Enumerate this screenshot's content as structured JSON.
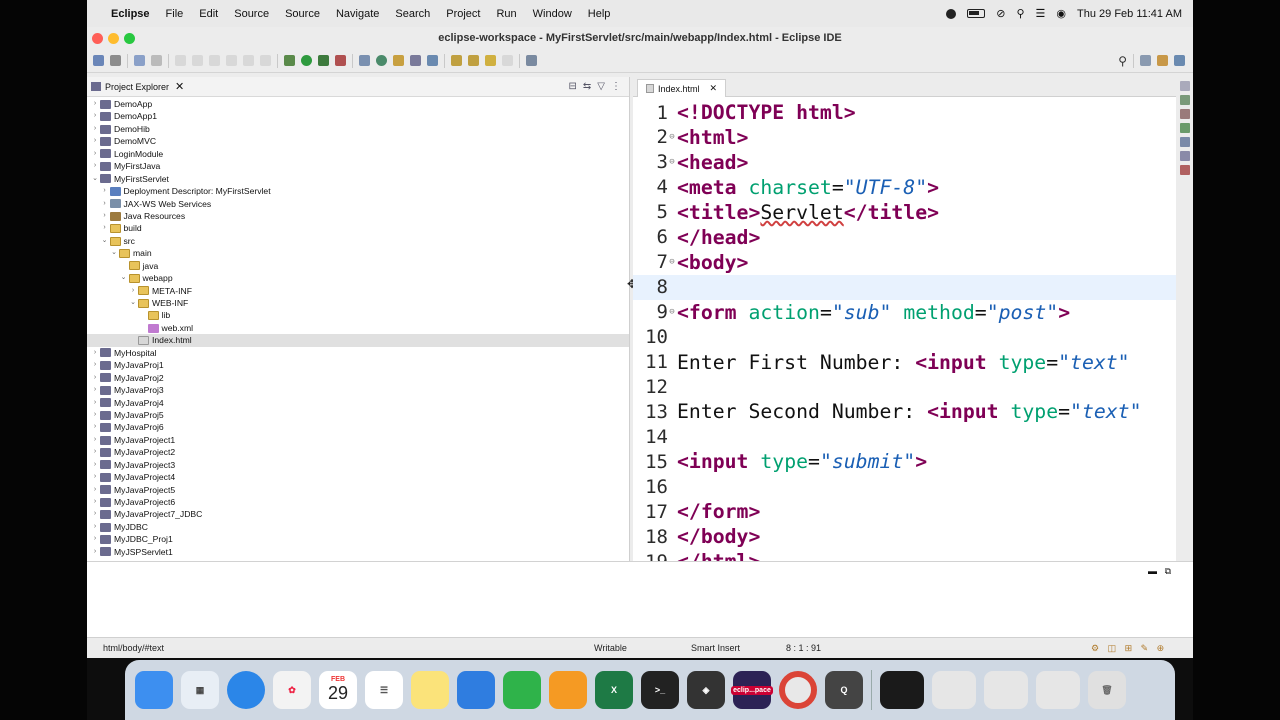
{
  "menubar": {
    "apple": "",
    "app_name": "Eclipse",
    "items": [
      "File",
      "Edit",
      "Source",
      "Source",
      "Navigate",
      "Search",
      "Project",
      "Run",
      "Window",
      "Help"
    ],
    "datetime": "Thu 29 Feb  11:41 AM"
  },
  "window": {
    "title": "eclipse-workspace - MyFirstServlet/src/main/webapp/Index.html - Eclipse IDE"
  },
  "explorer": {
    "title": "Project Explorer",
    "close": "✕",
    "tree": [
      {
        "label": "DemoApp",
        "arrow": "›",
        "icon": "proj",
        "depth": 0
      },
      {
        "label": "DemoApp1",
        "arrow": "›",
        "icon": "proj",
        "depth": 0
      },
      {
        "label": "DemoHib",
        "arrow": "›",
        "icon": "proj",
        "depth": 0
      },
      {
        "label": "DemoMVC",
        "arrow": "›",
        "icon": "proj",
        "depth": 0
      },
      {
        "label": "LoginModule",
        "arrow": "›",
        "icon": "proj",
        "depth": 0
      },
      {
        "label": "MyFirstJava",
        "arrow": "›",
        "icon": "proj",
        "depth": 0
      },
      {
        "label": "MyFirstServlet",
        "arrow": "⌄",
        "icon": "proj",
        "depth": 0
      },
      {
        "label": "Deployment Descriptor: MyFirstServlet",
        "arrow": "›",
        "icon": "desc",
        "depth": 1
      },
      {
        "label": "JAX-WS Web Services",
        "arrow": "›",
        "icon": "ws",
        "depth": 1
      },
      {
        "label": "Java Resources",
        "arrow": "›",
        "icon": "lib",
        "depth": 1
      },
      {
        "label": "build",
        "arrow": "›",
        "icon": "fold",
        "depth": 1
      },
      {
        "label": "src",
        "arrow": "⌄",
        "icon": "fold",
        "depth": 1
      },
      {
        "label": "main",
        "arrow": "⌄",
        "icon": "fold",
        "depth": 2
      },
      {
        "label": "java",
        "arrow": "",
        "icon": "fold",
        "depth": 3
      },
      {
        "label": "webapp",
        "arrow": "⌄",
        "icon": "fold",
        "depth": 3
      },
      {
        "label": "META-INF",
        "arrow": "›",
        "icon": "fold",
        "depth": 4
      },
      {
        "label": "WEB-INF",
        "arrow": "⌄",
        "icon": "fold",
        "depth": 4
      },
      {
        "label": "lib",
        "arrow": "",
        "icon": "fold",
        "depth": 5
      },
      {
        "label": "web.xml",
        "arrow": "",
        "icon": "xml",
        "depth": 5
      },
      {
        "label": "Index.html",
        "arrow": "",
        "icon": "html",
        "depth": 4,
        "selected": true
      },
      {
        "label": "MyHospital",
        "arrow": "›",
        "icon": "proj",
        "depth": 0
      },
      {
        "label": "MyJavaProj1",
        "arrow": "›",
        "icon": "proj",
        "depth": 0
      },
      {
        "label": "MyJavaProj2",
        "arrow": "›",
        "icon": "proj",
        "depth": 0
      },
      {
        "label": "MyJavaProj3",
        "arrow": "›",
        "icon": "proj",
        "depth": 0
      },
      {
        "label": "MyJavaProj4",
        "arrow": "›",
        "icon": "proj",
        "depth": 0
      },
      {
        "label": "MyJavaProj5",
        "arrow": "›",
        "icon": "proj",
        "depth": 0
      },
      {
        "label": "MyJavaProj6",
        "arrow": "›",
        "icon": "proj",
        "depth": 0
      },
      {
        "label": "MyJavaProject1",
        "arrow": "›",
        "icon": "proj",
        "depth": 0
      },
      {
        "label": "MyJavaProject2",
        "arrow": "›",
        "icon": "proj",
        "depth": 0
      },
      {
        "label": "MyJavaProject3",
        "arrow": "›",
        "icon": "proj",
        "depth": 0
      },
      {
        "label": "MyJavaProject4",
        "arrow": "›",
        "icon": "proj",
        "depth": 0
      },
      {
        "label": "MyJavaProject5",
        "arrow": "›",
        "icon": "proj",
        "depth": 0
      },
      {
        "label": "MyJavaProject6",
        "arrow": "›",
        "icon": "proj",
        "depth": 0
      },
      {
        "label": "MyJavaProject7_JDBC",
        "arrow": "›",
        "icon": "proj",
        "depth": 0
      },
      {
        "label": "MyJDBC",
        "arrow": "›",
        "icon": "proj",
        "depth": 0
      },
      {
        "label": "MyJDBC_Proj1",
        "arrow": "›",
        "icon": "proj",
        "depth": 0
      },
      {
        "label": "MyJSPServlet1",
        "arrow": "›",
        "icon": "proj",
        "depth": 0
      }
    ]
  },
  "editor": {
    "tab_label": "Index.html",
    "tab_close": "✕",
    "current_line": 8,
    "lines": [
      {
        "n": "1",
        "fold": "",
        "tokens": [
          [
            "tg",
            "<!DOCTYPE html>"
          ]
        ]
      },
      {
        "n": "2",
        "fold": "⊖",
        "tokens": [
          [
            "tg",
            "<html>"
          ]
        ]
      },
      {
        "n": "3",
        "fold": "⊖",
        "tokens": [
          [
            "tg",
            "<head>"
          ]
        ]
      },
      {
        "n": "4",
        "fold": "",
        "tokens": [
          [
            "tg",
            "<meta "
          ],
          [
            "at",
            "charset"
          ],
          [
            "tx",
            "="
          ],
          [
            "st",
            "\"UTF-8\""
          ],
          [
            "tg",
            ">"
          ]
        ]
      },
      {
        "n": "5",
        "fold": "",
        "tokens": [
          [
            "tg",
            "<title>"
          ],
          [
            "sq",
            "Servlet"
          ],
          [
            "tg",
            "</title>"
          ]
        ]
      },
      {
        "n": "6",
        "fold": "",
        "tokens": [
          [
            "tg",
            "</head>"
          ]
        ]
      },
      {
        "n": "7",
        "fold": "⊖",
        "tokens": [
          [
            "tg",
            "<body>"
          ]
        ]
      },
      {
        "n": "8",
        "fold": "",
        "tokens": []
      },
      {
        "n": "9",
        "fold": "⊖",
        "tokens": [
          [
            "tg",
            "<form "
          ],
          [
            "at",
            "action"
          ],
          [
            "tx",
            "="
          ],
          [
            "st",
            "\"sub\""
          ],
          [
            "tx",
            " "
          ],
          [
            "at",
            "method"
          ],
          [
            "tx",
            "="
          ],
          [
            "st",
            "\"post\""
          ],
          [
            "tg",
            ">"
          ]
        ]
      },
      {
        "n": "10",
        "fold": "",
        "tokens": []
      },
      {
        "n": "11",
        "fold": "",
        "tokens": [
          [
            "tx",
            "Enter First Number: "
          ],
          [
            "tg",
            "<input "
          ],
          [
            "at",
            "type"
          ],
          [
            "tx",
            "="
          ],
          [
            "st",
            "\"text\""
          ]
        ]
      },
      {
        "n": "12",
        "fold": "",
        "tokens": []
      },
      {
        "n": "13",
        "fold": "",
        "tokens": [
          [
            "tx",
            "Enter Second Number: "
          ],
          [
            "tg",
            "<input "
          ],
          [
            "at",
            "type"
          ],
          [
            "tx",
            "="
          ],
          [
            "st",
            "\"text\""
          ]
        ]
      },
      {
        "n": "14",
        "fold": "",
        "tokens": []
      },
      {
        "n": "15",
        "fold": "",
        "tokens": [
          [
            "tg",
            "<input "
          ],
          [
            "at",
            "type"
          ],
          [
            "tx",
            "="
          ],
          [
            "st",
            "\"submit\""
          ],
          [
            "tg",
            ">"
          ]
        ]
      },
      {
        "n": "16",
        "fold": "",
        "tokens": []
      },
      {
        "n": "17",
        "fold": "",
        "tokens": [
          [
            "tg",
            "</form>"
          ]
        ]
      },
      {
        "n": "18",
        "fold": "",
        "tokens": [
          [
            "tg",
            "</body>"
          ]
        ]
      },
      {
        "n": "19",
        "fold": "",
        "tokens": [
          [
            "tg",
            "</html>"
          ]
        ]
      }
    ]
  },
  "status": {
    "path": "html/body/#text",
    "mode": "Writable",
    "insert": "Smart Insert",
    "position": "8 : 1 : 91"
  },
  "dock": {
    "calendar_month": "FEB",
    "calendar_day": "29",
    "eclipse_label": "eclip...pace",
    "apps": [
      "finder",
      "launchpad",
      "safari",
      "photos",
      "calendar",
      "reminders",
      "notes",
      "keynote",
      "numbers",
      "pages",
      "excel",
      "terminal",
      "unity",
      "eclipse",
      "chrome",
      "quicktime"
    ]
  },
  "colors": {
    "tag": "#7f0055",
    "attribute": "#00a070",
    "string": "#1a5fb4",
    "current_line": "#e8f2fe",
    "selection": "#e0e0e0"
  }
}
